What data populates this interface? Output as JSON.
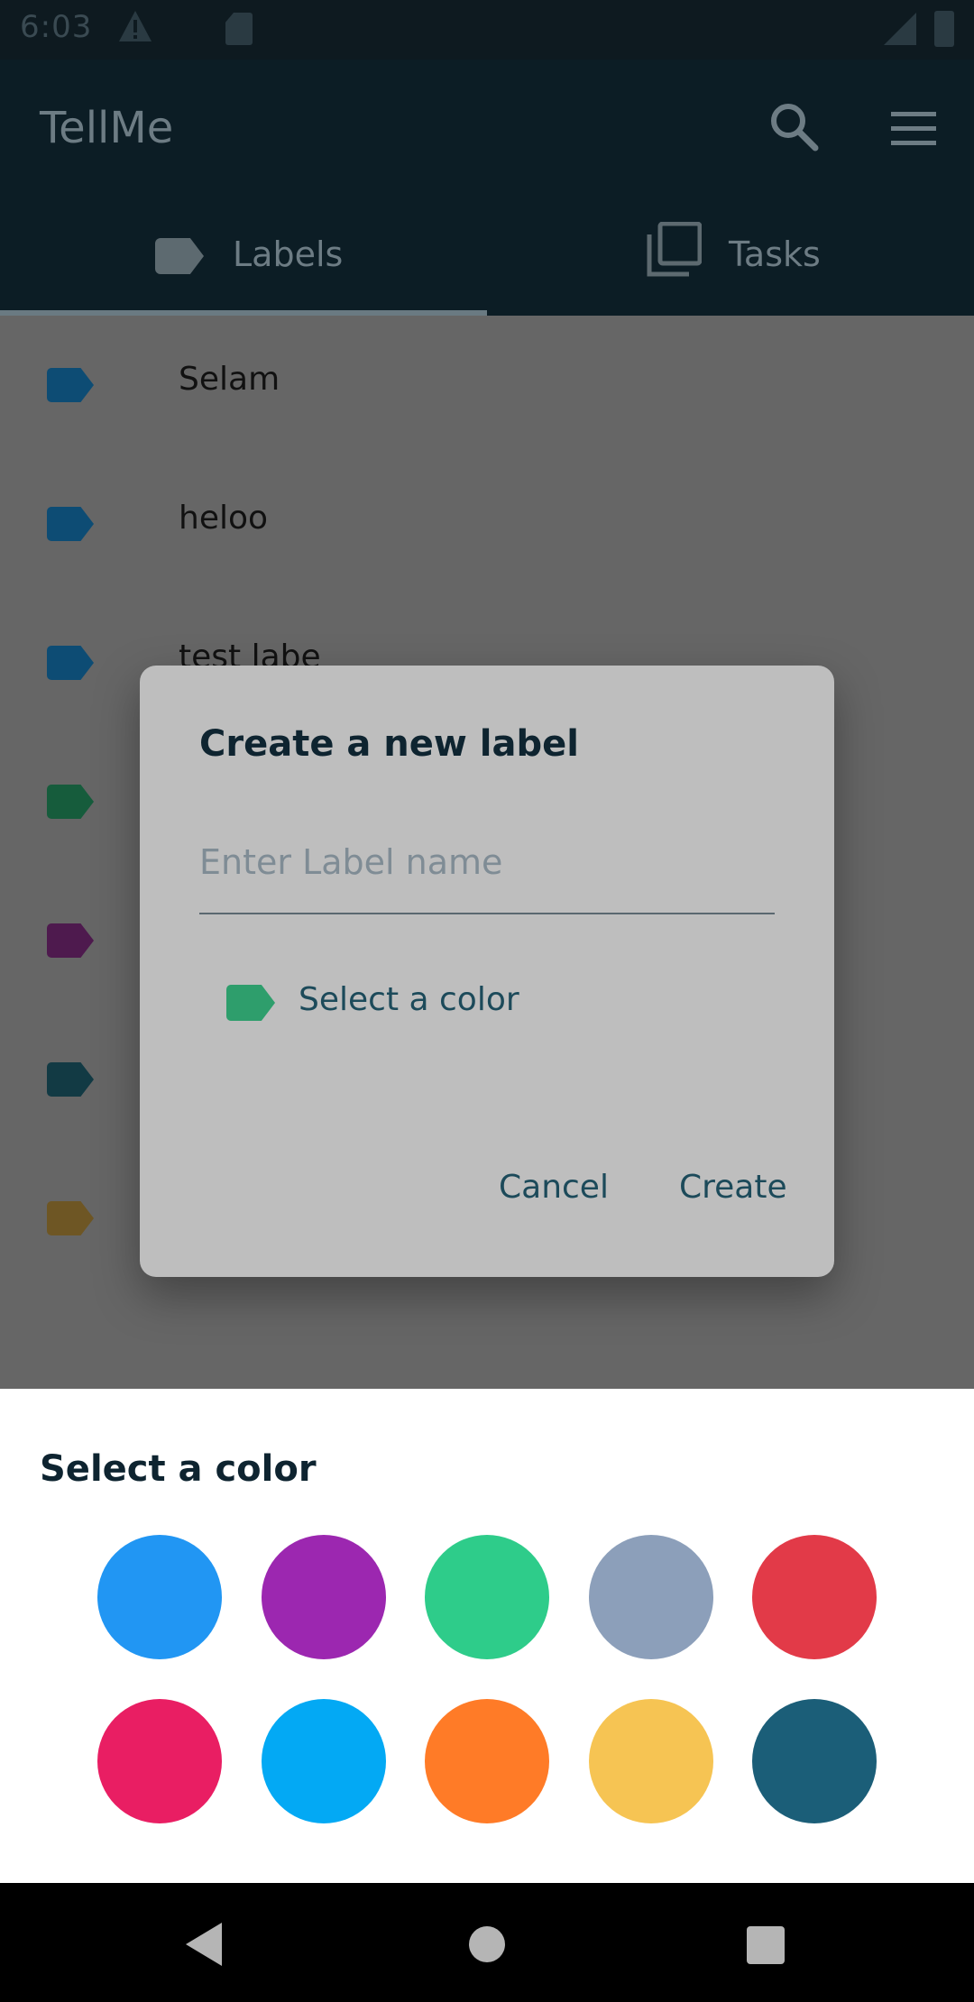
{
  "status_bar": {
    "time": "6:03"
  },
  "app_bar": {
    "title": "TellMe",
    "tabs": [
      {
        "label": "Labels",
        "icon": "label-icon",
        "selected": true
      },
      {
        "label": "Tasks",
        "icon": "tasks-icon",
        "selected": false
      }
    ]
  },
  "labels": [
    {
      "name": "Selam",
      "color": "#0d4c74"
    },
    {
      "name": "heloo",
      "color": "#0d4c74"
    },
    {
      "name": "test labe",
      "color": "#0d4c74"
    },
    {
      "name": "",
      "color": "#165c3c"
    },
    {
      "name": "",
      "color": "#4e1a4e"
    },
    {
      "name": "",
      "color": "#123a44"
    },
    {
      "name": "",
      "color": "#6e5624"
    }
  ],
  "dialog": {
    "title": "Create a new label",
    "input_placeholder": "Enter Label name",
    "input_value": "",
    "color_select_label": "Select a color",
    "selected_color": "#2e9e6c",
    "cancel_label": "Cancel",
    "create_label": "Create"
  },
  "sheet": {
    "title": "Select a color",
    "colors": [
      "#2196f3",
      "#9c27b0",
      "#2ecc8a",
      "#8c9fba",
      "#e23a48",
      "#e91e63",
      "#03a9f4",
      "#ff7b27",
      "#f6c453",
      "#1b5e78"
    ]
  }
}
